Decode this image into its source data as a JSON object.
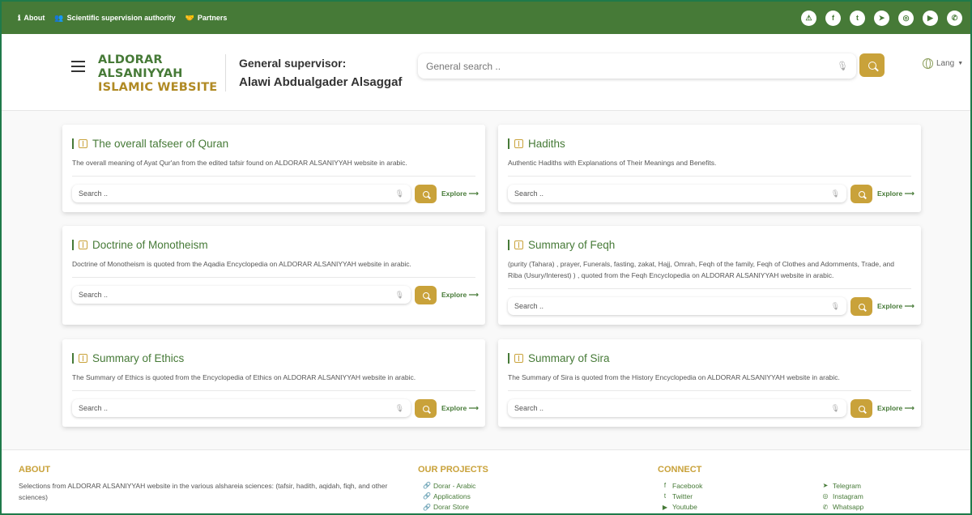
{
  "topbar": {
    "links": [
      {
        "label": "About",
        "icon": "info-icon"
      },
      {
        "label": "Scientific supervision authority",
        "icon": "users-icon"
      },
      {
        "label": "Partners",
        "icon": "handshake-icon"
      }
    ],
    "social": [
      {
        "name": "alert-icon",
        "glyph": "⚠"
      },
      {
        "name": "facebook-icon",
        "glyph": "f"
      },
      {
        "name": "twitter-icon",
        "glyph": "t"
      },
      {
        "name": "telegram-icon",
        "glyph": "➤"
      },
      {
        "name": "instagram-icon",
        "glyph": "◎"
      },
      {
        "name": "youtube-icon",
        "glyph": "▶"
      },
      {
        "name": "whatsapp-icon",
        "glyph": "✆"
      }
    ]
  },
  "header": {
    "logo_line1": "ALDORAR",
    "logo_line2": "ALSANIYYAH",
    "logo_line3": "ISLAMIC WEBSITE",
    "supervisor_label": "General supervisor:",
    "supervisor_name": "Alawi Abdualgader Alsaggaf",
    "search_placeholder": "General search ..",
    "lang_label": "Lang"
  },
  "cards": [
    {
      "title": "The overall tafseer of Quran",
      "desc": "The overall meaning of Ayat Qur'an from the edited tafsir found on ALDORAR ALSANIYYAH website in arabic.",
      "placeholder": "Search ..",
      "explore": "Explore"
    },
    {
      "title": "Hadiths",
      "desc": "Authentic Hadiths with Explanations of Their Meanings and Benefits.",
      "placeholder": "Search ..",
      "explore": "Explore"
    },
    {
      "title": "Doctrine of Monotheism",
      "desc": "Doctrine of Monotheism is quoted from the Aqadia Encyclopedia on ALDORAR ALSANIYYAH website in arabic.",
      "placeholder": "Search ..",
      "explore": "Explore"
    },
    {
      "title": "Summary of Feqh",
      "desc": "(purity (Tahara) , prayer, Funerals, fasting, zakat, Hajj, Omrah, Feqh of the family, Feqh of Clothes and Adornments, Trade, and Riba (Usury/Interest) ) , quoted from the Feqh Encyclopedia on ALDORAR ALSANIYYAH website in arabic.",
      "placeholder": "Search ..",
      "explore": "Explore"
    },
    {
      "title": "Summary of Ethics",
      "desc": "The Summary of Ethics is quoted from the Encyclopedia of Ethics on ALDORAR ALSANIYYAH website in arabic.",
      "placeholder": "Search ..",
      "explore": "Explore"
    },
    {
      "title": "Summary of Sira",
      "desc": "The Summary of Sira is quoted from the History Encyclopedia on ALDORAR ALSANIYYAH website in arabic.",
      "placeholder": "Search ..",
      "explore": "Explore"
    }
  ],
  "footer": {
    "about_title": "ABOUT",
    "about_text": "Selections from ALDORAR ALSANIYYAH website in the various alshareia sciences: (tafsir, hadith, aqidah, fiqh, and other sciences)",
    "projects_title": "OUR PROJECTS",
    "projects": [
      "Dorar - Arabic",
      "Applications",
      "Dorar Store"
    ],
    "connect_title": "CONNECT",
    "connect_col1": [
      "Facebook",
      "Twitter",
      "Youtube"
    ],
    "connect_col2": [
      "Telegram",
      "Instagram",
      "Whatsapp"
    ]
  },
  "colors": {
    "brand_green": "#467a37",
    "accent_gold": "#c9a23a"
  }
}
